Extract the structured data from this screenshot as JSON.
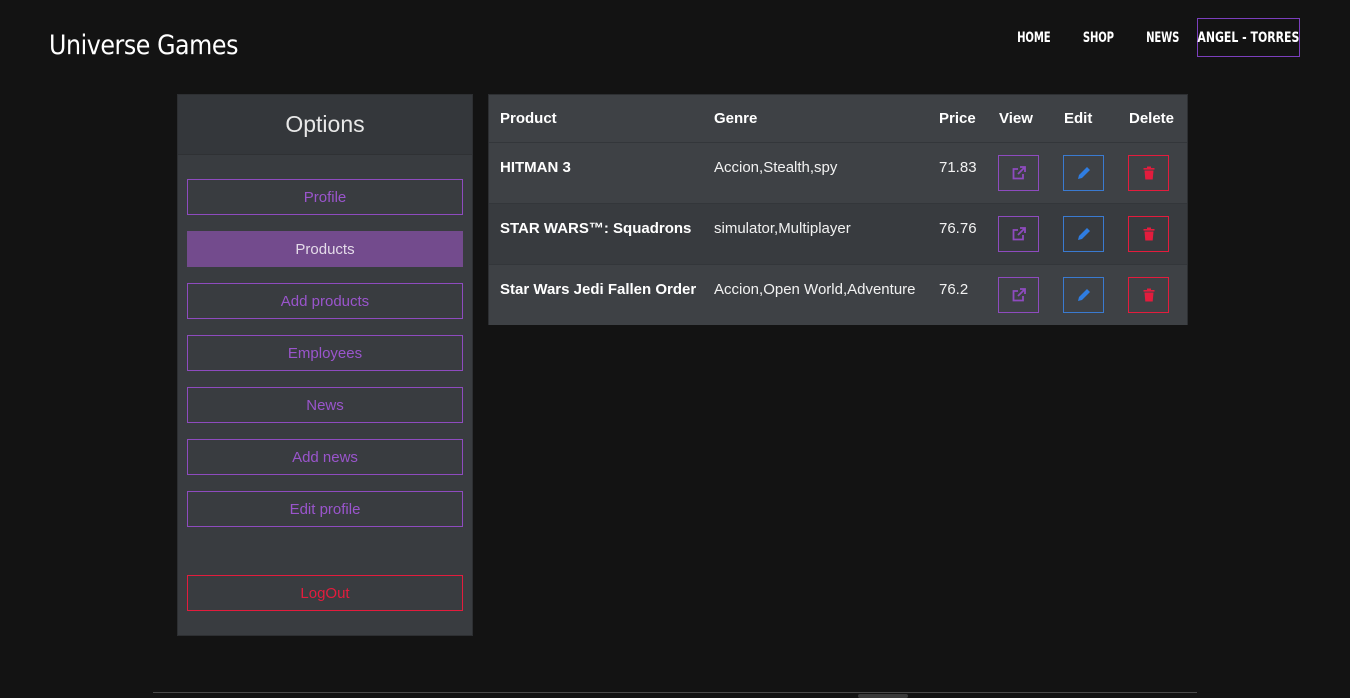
{
  "header": {
    "brand": "Universe Games",
    "nav": [
      "HOME",
      "SHOP",
      "NEWS"
    ],
    "user": "ANGEL - TORRES"
  },
  "sidebar": {
    "title": "Options",
    "items": [
      {
        "label": "Profile",
        "active": false
      },
      {
        "label": "Products",
        "active": true
      },
      {
        "label": "Add products",
        "active": false
      },
      {
        "label": "Employees",
        "active": false
      },
      {
        "label": "News",
        "active": false
      },
      {
        "label": "Add news",
        "active": false
      },
      {
        "label": "Edit profile",
        "active": false
      }
    ],
    "logout": "LogOut"
  },
  "table": {
    "headers": [
      "Product",
      "Genre",
      "Price",
      "View",
      "Edit",
      "Delete"
    ],
    "rows": [
      {
        "product": "HITMAN 3",
        "genre": "Accion,Stealth,spy",
        "price": "71.83"
      },
      {
        "product": "STAR WARS™: Squadrons",
        "genre": "simulator,Multiplayer",
        "price": "76.76"
      },
      {
        "product": "Star Wars Jedi Fallen Order",
        "genre": "Accion,Open World,Adventure",
        "price": "76.2"
      }
    ]
  },
  "colors": {
    "background": "#131313",
    "accent_purple": "#8e4bbf",
    "active_purple": "#734b8d",
    "edit_blue": "#3a7ad0",
    "danger_red": "#e31c3d"
  },
  "icons": {
    "view": "external-link-icon",
    "edit": "pencil-icon",
    "delete": "trash-icon"
  }
}
